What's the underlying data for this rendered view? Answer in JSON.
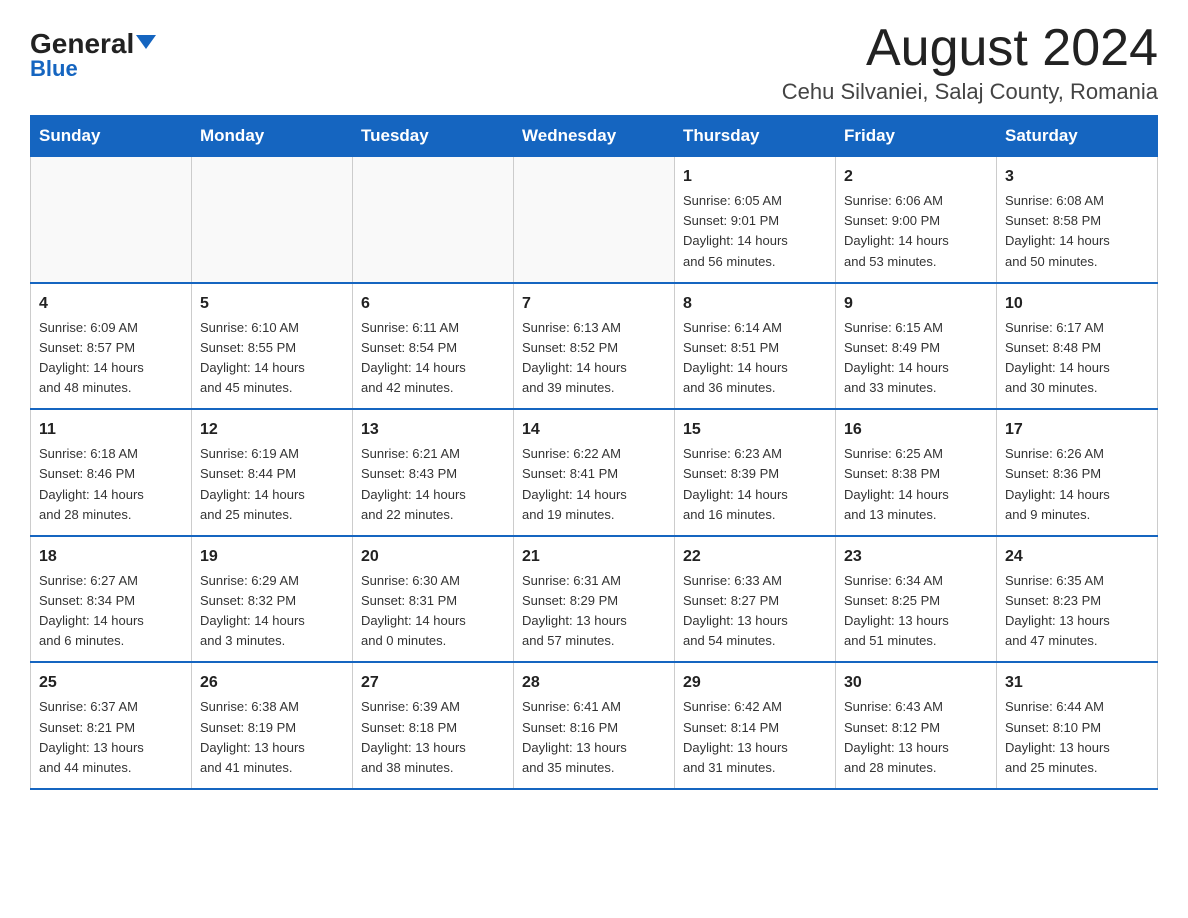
{
  "header": {
    "logo_general": "General",
    "logo_blue": "Blue",
    "month_title": "August 2024",
    "location": "Cehu Silvaniei, Salaj County, Romania"
  },
  "weekdays": [
    "Sunday",
    "Monday",
    "Tuesday",
    "Wednesday",
    "Thursday",
    "Friday",
    "Saturday"
  ],
  "weeks": [
    [
      {
        "day": "",
        "info": ""
      },
      {
        "day": "",
        "info": ""
      },
      {
        "day": "",
        "info": ""
      },
      {
        "day": "",
        "info": ""
      },
      {
        "day": "1",
        "info": "Sunrise: 6:05 AM\nSunset: 9:01 PM\nDaylight: 14 hours\nand 56 minutes."
      },
      {
        "day": "2",
        "info": "Sunrise: 6:06 AM\nSunset: 9:00 PM\nDaylight: 14 hours\nand 53 minutes."
      },
      {
        "day": "3",
        "info": "Sunrise: 6:08 AM\nSunset: 8:58 PM\nDaylight: 14 hours\nand 50 minutes."
      }
    ],
    [
      {
        "day": "4",
        "info": "Sunrise: 6:09 AM\nSunset: 8:57 PM\nDaylight: 14 hours\nand 48 minutes."
      },
      {
        "day": "5",
        "info": "Sunrise: 6:10 AM\nSunset: 8:55 PM\nDaylight: 14 hours\nand 45 minutes."
      },
      {
        "day": "6",
        "info": "Sunrise: 6:11 AM\nSunset: 8:54 PM\nDaylight: 14 hours\nand 42 minutes."
      },
      {
        "day": "7",
        "info": "Sunrise: 6:13 AM\nSunset: 8:52 PM\nDaylight: 14 hours\nand 39 minutes."
      },
      {
        "day": "8",
        "info": "Sunrise: 6:14 AM\nSunset: 8:51 PM\nDaylight: 14 hours\nand 36 minutes."
      },
      {
        "day": "9",
        "info": "Sunrise: 6:15 AM\nSunset: 8:49 PM\nDaylight: 14 hours\nand 33 minutes."
      },
      {
        "day": "10",
        "info": "Sunrise: 6:17 AM\nSunset: 8:48 PM\nDaylight: 14 hours\nand 30 minutes."
      }
    ],
    [
      {
        "day": "11",
        "info": "Sunrise: 6:18 AM\nSunset: 8:46 PM\nDaylight: 14 hours\nand 28 minutes."
      },
      {
        "day": "12",
        "info": "Sunrise: 6:19 AM\nSunset: 8:44 PM\nDaylight: 14 hours\nand 25 minutes."
      },
      {
        "day": "13",
        "info": "Sunrise: 6:21 AM\nSunset: 8:43 PM\nDaylight: 14 hours\nand 22 minutes."
      },
      {
        "day": "14",
        "info": "Sunrise: 6:22 AM\nSunset: 8:41 PM\nDaylight: 14 hours\nand 19 minutes."
      },
      {
        "day": "15",
        "info": "Sunrise: 6:23 AM\nSunset: 8:39 PM\nDaylight: 14 hours\nand 16 minutes."
      },
      {
        "day": "16",
        "info": "Sunrise: 6:25 AM\nSunset: 8:38 PM\nDaylight: 14 hours\nand 13 minutes."
      },
      {
        "day": "17",
        "info": "Sunrise: 6:26 AM\nSunset: 8:36 PM\nDaylight: 14 hours\nand 9 minutes."
      }
    ],
    [
      {
        "day": "18",
        "info": "Sunrise: 6:27 AM\nSunset: 8:34 PM\nDaylight: 14 hours\nand 6 minutes."
      },
      {
        "day": "19",
        "info": "Sunrise: 6:29 AM\nSunset: 8:32 PM\nDaylight: 14 hours\nand 3 minutes."
      },
      {
        "day": "20",
        "info": "Sunrise: 6:30 AM\nSunset: 8:31 PM\nDaylight: 14 hours\nand 0 minutes."
      },
      {
        "day": "21",
        "info": "Sunrise: 6:31 AM\nSunset: 8:29 PM\nDaylight: 13 hours\nand 57 minutes."
      },
      {
        "day": "22",
        "info": "Sunrise: 6:33 AM\nSunset: 8:27 PM\nDaylight: 13 hours\nand 54 minutes."
      },
      {
        "day": "23",
        "info": "Sunrise: 6:34 AM\nSunset: 8:25 PM\nDaylight: 13 hours\nand 51 minutes."
      },
      {
        "day": "24",
        "info": "Sunrise: 6:35 AM\nSunset: 8:23 PM\nDaylight: 13 hours\nand 47 minutes."
      }
    ],
    [
      {
        "day": "25",
        "info": "Sunrise: 6:37 AM\nSunset: 8:21 PM\nDaylight: 13 hours\nand 44 minutes."
      },
      {
        "day": "26",
        "info": "Sunrise: 6:38 AM\nSunset: 8:19 PM\nDaylight: 13 hours\nand 41 minutes."
      },
      {
        "day": "27",
        "info": "Sunrise: 6:39 AM\nSunset: 8:18 PM\nDaylight: 13 hours\nand 38 minutes."
      },
      {
        "day": "28",
        "info": "Sunrise: 6:41 AM\nSunset: 8:16 PM\nDaylight: 13 hours\nand 35 minutes."
      },
      {
        "day": "29",
        "info": "Sunrise: 6:42 AM\nSunset: 8:14 PM\nDaylight: 13 hours\nand 31 minutes."
      },
      {
        "day": "30",
        "info": "Sunrise: 6:43 AM\nSunset: 8:12 PM\nDaylight: 13 hours\nand 28 minutes."
      },
      {
        "day": "31",
        "info": "Sunrise: 6:44 AM\nSunset: 8:10 PM\nDaylight: 13 hours\nand 25 minutes."
      }
    ]
  ]
}
